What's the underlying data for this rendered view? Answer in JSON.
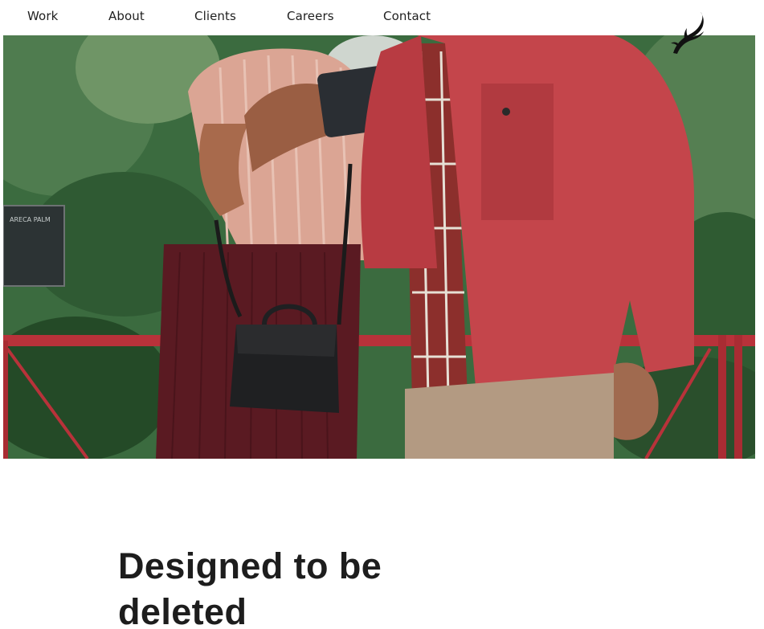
{
  "nav": {
    "items": [
      {
        "label": "Work"
      },
      {
        "label": "About"
      },
      {
        "label": "Clients"
      },
      {
        "label": "Careers"
      },
      {
        "label": "Contact"
      }
    ]
  },
  "logo": {
    "icon": "antler-icon"
  },
  "hero": {
    "sign_text": "ARECA PALM"
  },
  "headline": {
    "line1": "Designed to be",
    "line2": "deleted"
  },
  "colors": {
    "text": "#1d1d1d",
    "jacket": "#c4454b",
    "skirt": "#5a1a22",
    "foliage": "#3b6b3f",
    "railing": "#b8323a"
  }
}
